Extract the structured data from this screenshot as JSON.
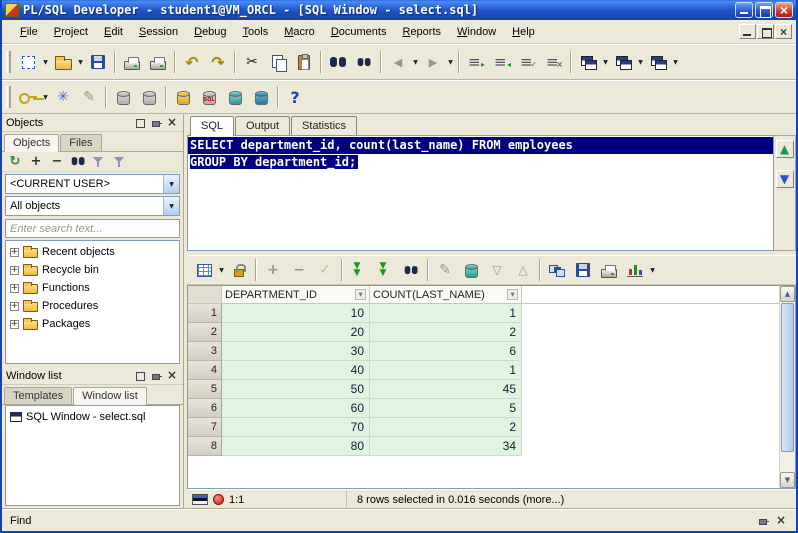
{
  "window": {
    "title": "PL/SQL Developer - student1@VM_ORCL - [SQL Window - select.sql]"
  },
  "menu": {
    "items": [
      "File",
      "Project",
      "Edit",
      "Session",
      "Debug",
      "Tools",
      "Macro",
      "Documents",
      "Reports",
      "Window",
      "Help"
    ]
  },
  "toolbar_icons": {
    "standard": [
      "new",
      "open",
      "save",
      "print",
      "print-selection",
      "undo",
      "redo",
      "cut",
      "copy",
      "paste",
      "find",
      "find-next",
      "back",
      "forward",
      "indent",
      "outdent",
      "comment",
      "uncomment",
      "cascade-windows",
      "tile-windows",
      "window-list"
    ],
    "session": [
      "logon",
      "configure",
      "edit",
      "commit",
      "rollback",
      "execute",
      "sql-window",
      "test-window",
      "command-window",
      "help"
    ],
    "grid": [
      "change-layout",
      "lock",
      "insert-record",
      "delete-record",
      "post-changes",
      "fetch-next-page",
      "fetch-all",
      "find",
      "edit-data",
      "export",
      "sort-descending",
      "sort-ascending",
      "single-record-view",
      "save-results",
      "print-results",
      "chart"
    ]
  },
  "objects_panel": {
    "title": "Objects",
    "tabs": [
      "Objects",
      "Files"
    ],
    "user_combo": "<CURRENT USER>",
    "filter_combo": "All objects",
    "search_placeholder": "Enter search text...",
    "tree_items": [
      "Recent objects",
      "Recycle bin",
      "Functions",
      "Procedures",
      "Packages"
    ]
  },
  "window_list_panel": {
    "title": "Window list",
    "tabs": [
      "Templates",
      "Window list"
    ],
    "items": [
      "SQL Window - select.sql"
    ]
  },
  "main": {
    "tabs": [
      "SQL",
      "Output",
      "Statistics"
    ],
    "sql_lines": [
      "SELECT department_id, count(last_name) FROM employees",
      "GROUP BY department_id;"
    ]
  },
  "results": {
    "columns": [
      "DEPARTMENT_ID",
      "COUNT(LAST_NAME)"
    ],
    "rows": [
      {
        "n": "1",
        "department_id": "10",
        "count": "1"
      },
      {
        "n": "2",
        "department_id": "20",
        "count": "2"
      },
      {
        "n": "3",
        "department_id": "30",
        "count": "6"
      },
      {
        "n": "4",
        "department_id": "40",
        "count": "1"
      },
      {
        "n": "5",
        "department_id": "50",
        "count": "45"
      },
      {
        "n": "6",
        "department_id": "60",
        "count": "5"
      },
      {
        "n": "7",
        "department_id": "70",
        "count": "2"
      },
      {
        "n": "8",
        "department_id": "80",
        "count": "34"
      }
    ]
  },
  "status_bar": {
    "position": "1:1",
    "message": "8 rows selected in 0.016 seconds (more...)"
  },
  "find_bar": {
    "label": "Find"
  },
  "colors": {
    "titlebar_blue": "#1e55cc",
    "selection_navy": "#000080",
    "result_row_green": "#dff5e2"
  }
}
